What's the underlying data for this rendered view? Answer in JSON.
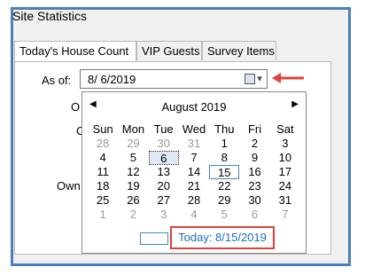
{
  "window": {
    "title": "Site Statistics"
  },
  "tabs": [
    {
      "label": "Today's House Count"
    },
    {
      "label": "VIP Guests"
    },
    {
      "label": "Survey Items"
    }
  ],
  "asof": {
    "label": "As of:",
    "value": "8/  6/2019"
  },
  "partial_labels": [
    "O",
    "C",
    "Own"
  ],
  "calendar": {
    "month_label": "August 2019",
    "weekdays": [
      "Sun",
      "Mon",
      "Tue",
      "Wed",
      "Thu",
      "Fri",
      "Sat"
    ],
    "weeks": [
      [
        "28",
        "29",
        "30",
        "31",
        "1",
        "2",
        "3"
      ],
      [
        "4",
        "5",
        "6",
        "7",
        "8",
        "9",
        "10"
      ],
      [
        "11",
        "12",
        "13",
        "14",
        "15",
        "16",
        "17"
      ],
      [
        "18",
        "19",
        "20",
        "21",
        "22",
        "23",
        "24"
      ],
      [
        "25",
        "26",
        "27",
        "28",
        "29",
        "30",
        "31"
      ],
      [
        "1",
        "2",
        "3",
        "4",
        "5",
        "6",
        "7"
      ]
    ],
    "selected_day": "6",
    "today_day": "15",
    "today_link": "Today: 8/15/2019"
  },
  "colors": {
    "highlight_box": "#e0403a",
    "link": "#1f6fc2",
    "frame": "#4a7fbf"
  },
  "icons": {
    "dropdown": "calendar-dropdown-icon",
    "pointer": "red-arrow-icon"
  }
}
